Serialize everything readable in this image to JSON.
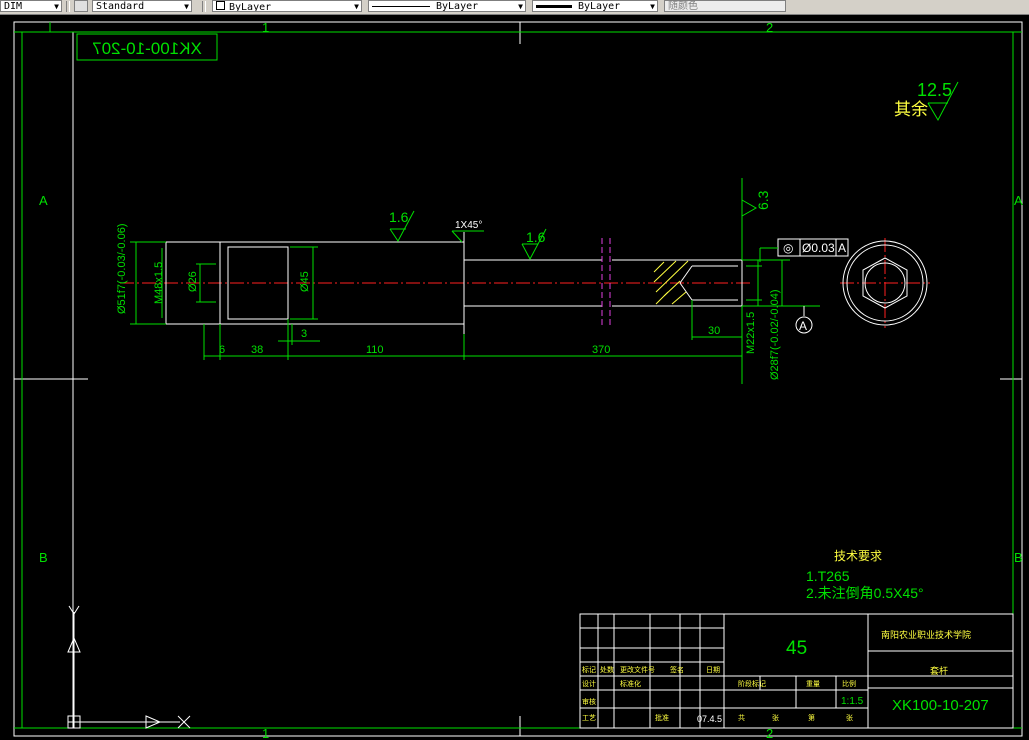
{
  "toolbar": {
    "dimstyle_value": "DIM",
    "textstyle_value": "Standard",
    "layer_value": "ByLayer",
    "linetype_value": "ByLayer",
    "lineweight_value": "ByLayer",
    "color_value": "随颜色"
  },
  "drawing": {
    "grid_col_1": "1",
    "grid_col_2": "2",
    "grid_row_a": "A",
    "grid_row_b": "B",
    "title_mirror": "XK100-10-207",
    "surface_rest": "其余",
    "surface_rest_value": "12.5",
    "roughness_1": "1.6",
    "roughness_2": "1.6",
    "roughness_3": "6.3",
    "chamfer": "1X45°",
    "tolerance_frame": [
      "◎",
      "Ø0.03",
      "A"
    ],
    "datum": "A",
    "dims": {
      "d1": "Ø51f7(-0.03/-0.06)",
      "d2": "M48x1.5",
      "d3": "Ø26",
      "d4": "Ø45",
      "d5": "M22x1.5",
      "d6": "Ø28f7(-0.02/-0.04)",
      "l_6": "6",
      "l_38": "38",
      "l_3": "3",
      "l_110": "110",
      "l_370": "370",
      "l_30": "30"
    },
    "tech_title": "技术要求",
    "tech_req_1": "1.T265",
    "tech_req_2": "2.未注倒角0.5X45°",
    "material": "45",
    "school": "南阳农业职业技术学院",
    "part_name": "套杆",
    "scale": "1:1.5",
    "date": "07.4.5",
    "drawing_no": "XK100-10-207",
    "tb_small": [
      "标记",
      "处数",
      "更改文件号",
      "签名",
      "日期",
      "设计",
      "标准化",
      "审核",
      "工艺",
      "批准",
      "阶段标记",
      "重量",
      "比例",
      "共",
      "张",
      "第",
      "张"
    ]
  },
  "colors": {
    "frame": "#ffffff",
    "dim": "#00e000",
    "center": "#ff2020",
    "cut": "#e040e0",
    "label": "#00ff00",
    "yellow": "#ffff40"
  }
}
